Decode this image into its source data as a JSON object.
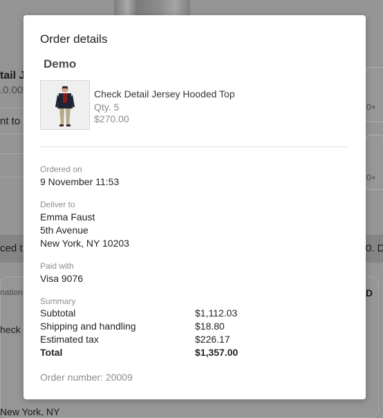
{
  "background": {
    "item_title_partial": "tail J",
    "item_price_partial": ".0.00",
    "button_partial": "nt to",
    "banner_left_partial": "ced t",
    "banner_right_partial": "0. D",
    "info_label_partial": "nation",
    "info_right_partial": "D",
    "check_partial": "heck",
    "address_partial": "New York, NY",
    "plus_badge_1": "0+",
    "plus_badge_2": "0+"
  },
  "modal": {
    "title": "Order details",
    "store_name": "Demo",
    "product": {
      "name": "Check Detail Jersey Hooded Top",
      "qty": "Qty. 5",
      "price": "$270.00"
    },
    "ordered_on": {
      "label": "Ordered on",
      "value": "9 November 11:53"
    },
    "deliver_to": {
      "label": "Deliver to",
      "name": "Emma Faust",
      "street": "5th Avenue",
      "city": "New York, NY 10203"
    },
    "paid_with": {
      "label": "Paid with",
      "value": "Visa 9076"
    },
    "summary": {
      "label": "Summary",
      "rows": [
        {
          "label": "Subtotal",
          "amount": "$1,112.03"
        },
        {
          "label": "Shipping and handling",
          "amount": "$18.80"
        },
        {
          "label": "Estimated tax",
          "amount": "$226.17"
        },
        {
          "label": "Total",
          "amount": "$1,357.00"
        }
      ]
    },
    "order_number": "Order number: 20009"
  }
}
